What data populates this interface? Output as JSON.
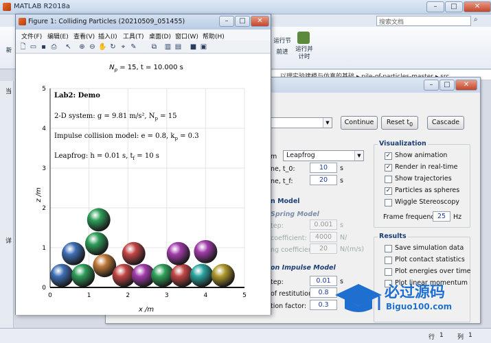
{
  "main_window": {
    "title": "MATLAB R2018a",
    "search_placeholder": "搜索文档",
    "ribbon": {
      "new_label": "新",
      "run_section": "运行节",
      "advance": "前进",
      "run_time": "运行并",
      "run_time2": "计时"
    },
    "address": "…以理实验建模与仿真的基础 ▸ pile-of-particles-master ▸ src",
    "left_labels": [
      "当",
      "详"
    ],
    "status": {
      "row_label": "行",
      "row": "1",
      "col_label": "列",
      "col": "1"
    }
  },
  "figure": {
    "title": "Figure 1: Colliding Particles (20210509_051455)",
    "menu": [
      "文件(F)",
      "编辑(E)",
      "查看(V)",
      "插入(I)",
      "工具(T)",
      "桌面(D)",
      "窗口(W)",
      "帮助(H)"
    ],
    "plot_title_pre": "N",
    "plot_title_sub": "p",
    "plot_title_post": " = 15, t = 10.000 s",
    "annot_head": "Lab2: Demo",
    "annot_l1": "2-D system: g = 9.81 m/s², N",
    "annot_l1_sub": "p",
    "annot_l1_post": " = 15",
    "annot_l2": "Impulse collision model: e = 0.8,  k",
    "annot_l2_sub": "p",
    "annot_l2_post": " = 0.3",
    "annot_l3": "Leapfrog: h = 0.01 s,  t",
    "annot_l3_sub": "f",
    "annot_l3_post": " = 10 s",
    "xlabel": "x /m",
    "ylabel": "z /m",
    "xticks": [
      "0",
      "1",
      "2",
      "3",
      "4",
      "5"
    ],
    "yticks": [
      "0",
      "1",
      "2",
      "3",
      "4",
      "5"
    ],
    "balls": [
      {
        "x": 0.3,
        "z": 0.3,
        "color": "#3f6fb6"
      },
      {
        "x": 0.85,
        "z": 0.3,
        "color": "#2e9e59"
      },
      {
        "x": 1.4,
        "z": 0.55,
        "color": "#c07a3a"
      },
      {
        "x": 1.9,
        "z": 0.3,
        "color": "#c24545"
      },
      {
        "x": 2.4,
        "z": 0.3,
        "color": "#a23cab"
      },
      {
        "x": 2.9,
        "z": 0.3,
        "color": "#2fa35a"
      },
      {
        "x": 3.4,
        "z": 0.3,
        "color": "#c24545"
      },
      {
        "x": 3.9,
        "z": 0.3,
        "color": "#2aa5a0"
      },
      {
        "x": 4.45,
        "z": 0.3,
        "color": "#b09a2c"
      },
      {
        "x": 0.6,
        "z": 0.85,
        "color": "#3f6fb6"
      },
      {
        "x": 1.2,
        "z": 1.1,
        "color": "#2e9e59"
      },
      {
        "x": 2.15,
        "z": 0.85,
        "color": "#c24545"
      },
      {
        "x": 3.3,
        "z": 0.85,
        "color": "#a23cab"
      },
      {
        "x": 4.0,
        "z": 0.9,
        "color": "#a23cab"
      },
      {
        "x": 1.25,
        "z": 1.7,
        "color": "#2e9e59"
      }
    ]
  },
  "gui": {
    "continue_label": "Continue",
    "reset_label": "Reset t",
    "reset_sub": "0",
    "cascade_label": "Cascade",
    "integrator_label": "m",
    "integrator_value": "Leapfrog",
    "t0_label": "ne, t_0:",
    "t0_value": "10",
    "t0_unit": "s",
    "tf_label": "ne, t_f:",
    "tf_value": "20",
    "tf_unit": "s",
    "model_head": "n Model",
    "spring_head": "Spring Model",
    "spring_step_label": "tep:",
    "spring_step_value": "0.001",
    "spring_step_unit": "s",
    "spring_coef_label": "coefficient:",
    "spring_coef_value": "4000",
    "spring_coef_unit": "N/",
    "spring_damp_label": "ng coefficient:",
    "spring_damp_value": "20",
    "spring_damp_unit": "N/(m/s)",
    "impulse_head": "on Impulse Model",
    "imp_step_label": "tep:",
    "imp_step_value": "0.01",
    "imp_step_unit": "s",
    "imp_rest_label": "of restitution:",
    "imp_rest_value": "0.8",
    "imp_fric_label": "tion factor:",
    "imp_fric_value": "0.3",
    "viz_head": "Visualization",
    "viz": [
      {
        "label": "Show animation",
        "checked": true
      },
      {
        "label": "Render in real-time",
        "checked": true
      },
      {
        "label": "Show trajectories",
        "checked": false
      },
      {
        "label": "Particles as spheres",
        "checked": true
      },
      {
        "label": "Wiggle Stereoscopy",
        "checked": false
      }
    ],
    "frame_freq_label": "Frame frequency:",
    "frame_freq_value": "25",
    "frame_freq_unit": "Hz",
    "results_head": "Results",
    "results": [
      {
        "label": "Save simulation data",
        "checked": false
      },
      {
        "label": "Plot contact statistics",
        "checked": false
      },
      {
        "label": "Plot energies over time",
        "checked": false
      },
      {
        "label": "Plot linear momentum",
        "checked": false
      }
    ]
  },
  "watermark": {
    "text": "必过源码",
    "url": "Biguo100.com"
  }
}
